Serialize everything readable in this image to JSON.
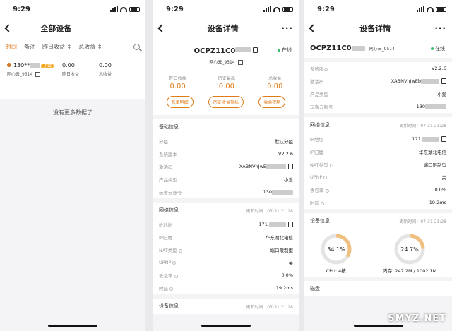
{
  "status_time": "9:29",
  "s1": {
    "title": "全部设备",
    "filters": [
      "时间",
      "备注",
      "昨日收益 ⇕",
      "总收益 ⇕"
    ],
    "device": {
      "phone": "130**",
      "tag": "小爱",
      "alias": "网心云_9514",
      "cols": [
        {
          "val": "0.00",
          "lbl": "昨日收益"
        },
        {
          "val": "0.00",
          "lbl": "总收益"
        }
      ]
    },
    "no_more": "没有更多数据了"
  },
  "s2": {
    "title": "设备详情",
    "device_id": "OCPZ11C0",
    "online": "在线",
    "alias": "网心云_9514",
    "stats": [
      {
        "lbl": "昨日收益",
        "val": "0.00"
      },
      {
        "lbl": "历史最高",
        "val": "0.00"
      },
      {
        "lbl": "总收益",
        "val": "0.00"
      }
    ],
    "buttons": [
      "账单明细",
      "历史收益指标",
      "收益攻略"
    ],
    "basic_title": "基础信息",
    "basic": [
      {
        "k": "分组",
        "v": "默认分组"
      },
      {
        "k": "系统版本",
        "v": "V2.2.6"
      },
      {
        "k": "激活码",
        "v": "XABNVnJwE"
      },
      {
        "k": "产品类型",
        "v": "小爱"
      },
      {
        "k": "玩客云账号",
        "v": "130"
      }
    ],
    "net_title": "网络信息",
    "net_time": "更新时间：07-31 21:28",
    "net": [
      {
        "k": "IP地址",
        "v": "171."
      },
      {
        "k": "IP归属",
        "v": "华东湖北电信"
      },
      {
        "k": "NAT类型",
        "v": "端口限制型"
      },
      {
        "k": "UPNP",
        "v": "关"
      },
      {
        "k": "丢包率",
        "v": "0.0%"
      },
      {
        "k": "时延",
        "v": "19.2ms"
      }
    ],
    "dev_title": "设备信息",
    "dev_time": "更新时间：07-31 21:28"
  },
  "s3": {
    "title": "设备详情",
    "device_id": "OCPZ11C0",
    "alias": "网心云_9514",
    "online": "在线",
    "basic": [
      {
        "k": "系统版本",
        "v": "V2.2.6"
      },
      {
        "k": "激活码",
        "v": "XABNVnJwEb"
      },
      {
        "k": "产品类型",
        "v": "小爱"
      },
      {
        "k": "玩客云账号",
        "v": "130"
      }
    ],
    "net_title": "网络信息",
    "net_time": "更新时间：07-31 21:28",
    "net": [
      {
        "k": "IP地址",
        "v": "171."
      },
      {
        "k": "IP归属",
        "v": "华东湖北电信"
      },
      {
        "k": "NAT类型",
        "v": "端口限制型"
      },
      {
        "k": "UPNP",
        "v": "关"
      },
      {
        "k": "丢包率",
        "v": "0.0%"
      },
      {
        "k": "时延",
        "v": "19.2ms"
      }
    ],
    "dev_title": "设备信息",
    "dev_time": "更新时间：07-31 21:28",
    "cpu_pct": "34.1%",
    "cpu_value": 0.341,
    "cpu_label": "CPU: 4核",
    "mem_pct": "24.7%",
    "mem_value": 0.247,
    "mem_label": "内存: 247.2M / 1002.1M",
    "disk_title": "磁盘"
  },
  "watermark": "SMYZ.NET",
  "colors": {
    "accent": "#e07b1a",
    "ring": "#f0c080",
    "online": "#35c06a"
  }
}
